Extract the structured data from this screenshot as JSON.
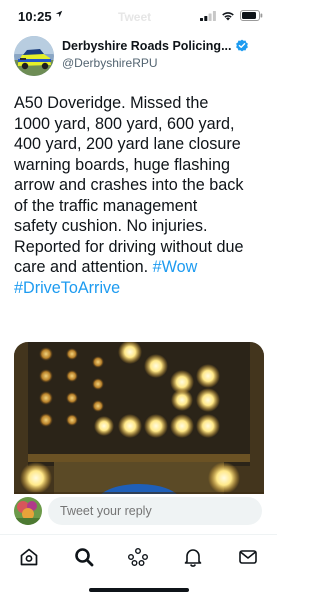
{
  "status_bar": {
    "time": "10:25",
    "ghost_title": "Tweet"
  },
  "author": {
    "name": "Derbyshire Roads Policing...",
    "handle": "@DerbyshireRPU",
    "verified": true
  },
  "tweet": {
    "lines": [
      "A50 Doveridge. Missed the",
      "1000 yard, 800 yard, 600 yard,",
      "400 yard, 200 yard lane closure",
      "warning boards, huge flashing",
      "arrow and crashes into the back",
      "of the traffic management",
      "safety cushion. No injuries.",
      "Reported for driving without due"
    ],
    "line9_text": "care and attention. ",
    "hashtag_wow": "#Wow",
    "hashtag_drive": "#DriveToArrive"
  },
  "reply": {
    "placeholder": "Tweet your reply"
  },
  "tabs": [
    {
      "icon": "home-icon"
    },
    {
      "icon": "search-icon"
    },
    {
      "icon": "spaces-icon"
    },
    {
      "icon": "notifications-icon"
    },
    {
      "icon": "messages-icon"
    }
  ],
  "colors": {
    "accent": "#1d9bf0",
    "text": "#0f1419",
    "secondary": "#536471",
    "input_bg": "#eff3f4"
  }
}
